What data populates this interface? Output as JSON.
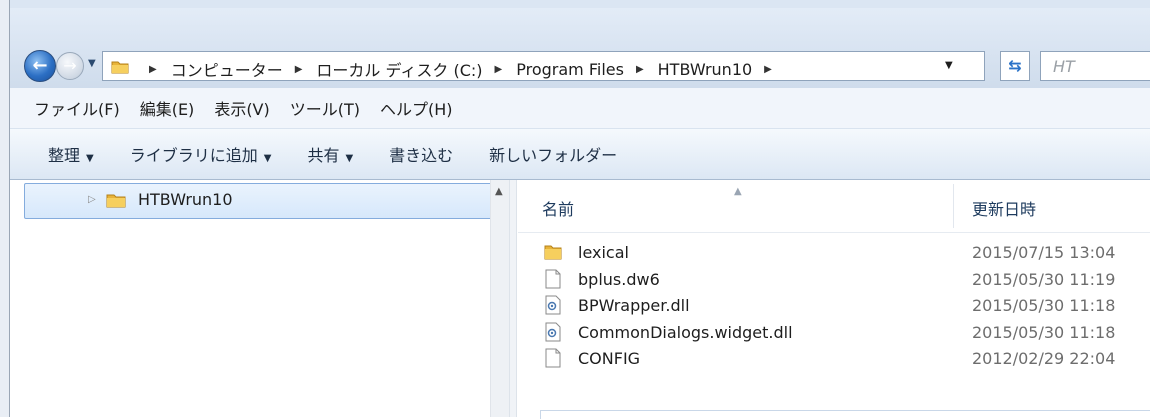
{
  "address_bar": {
    "breadcrumbs": [
      "コンピューター",
      "ローカル ディスク (C:)",
      "Program Files",
      "HTBWrun10"
    ],
    "search_placeholder": "HT"
  },
  "menu": [
    "ファイル(F)",
    "編集(E)",
    "表示(V)",
    "ツール(T)",
    "ヘルプ(H)"
  ],
  "commands": [
    {
      "label": "整理",
      "dropdown": true
    },
    {
      "label": "ライブラリに追加",
      "dropdown": true
    },
    {
      "label": "共有",
      "dropdown": true
    },
    {
      "label": "書き込む",
      "dropdown": false
    },
    {
      "label": "新しいフォルダー",
      "dropdown": false
    }
  ],
  "nav_pane": {
    "selected_folder": "HTBWrun10"
  },
  "file_list": {
    "columns": {
      "name": "名前",
      "modified": "更新日時"
    },
    "rows": [
      {
        "name": "lexical",
        "date": "2015/07/15 13:04",
        "icon": "folder-icon"
      },
      {
        "name": "bplus.dw6",
        "date": "2015/05/30 11:19",
        "icon": "file-icon"
      },
      {
        "name": "BPWrapper.dll",
        "date": "2015/05/30 11:18",
        "icon": "dll-icon"
      },
      {
        "name": "CommonDialogs.widget.dll",
        "date": "2015/05/30 11:18",
        "icon": "dll-icon"
      },
      {
        "name": "CONFIG",
        "date": "2012/02/29 22:04",
        "icon": "file-icon"
      }
    ]
  },
  "colors": {
    "folder": "#e8b339",
    "selection": "#d6e8fb",
    "accent": "#2c6fc4"
  }
}
